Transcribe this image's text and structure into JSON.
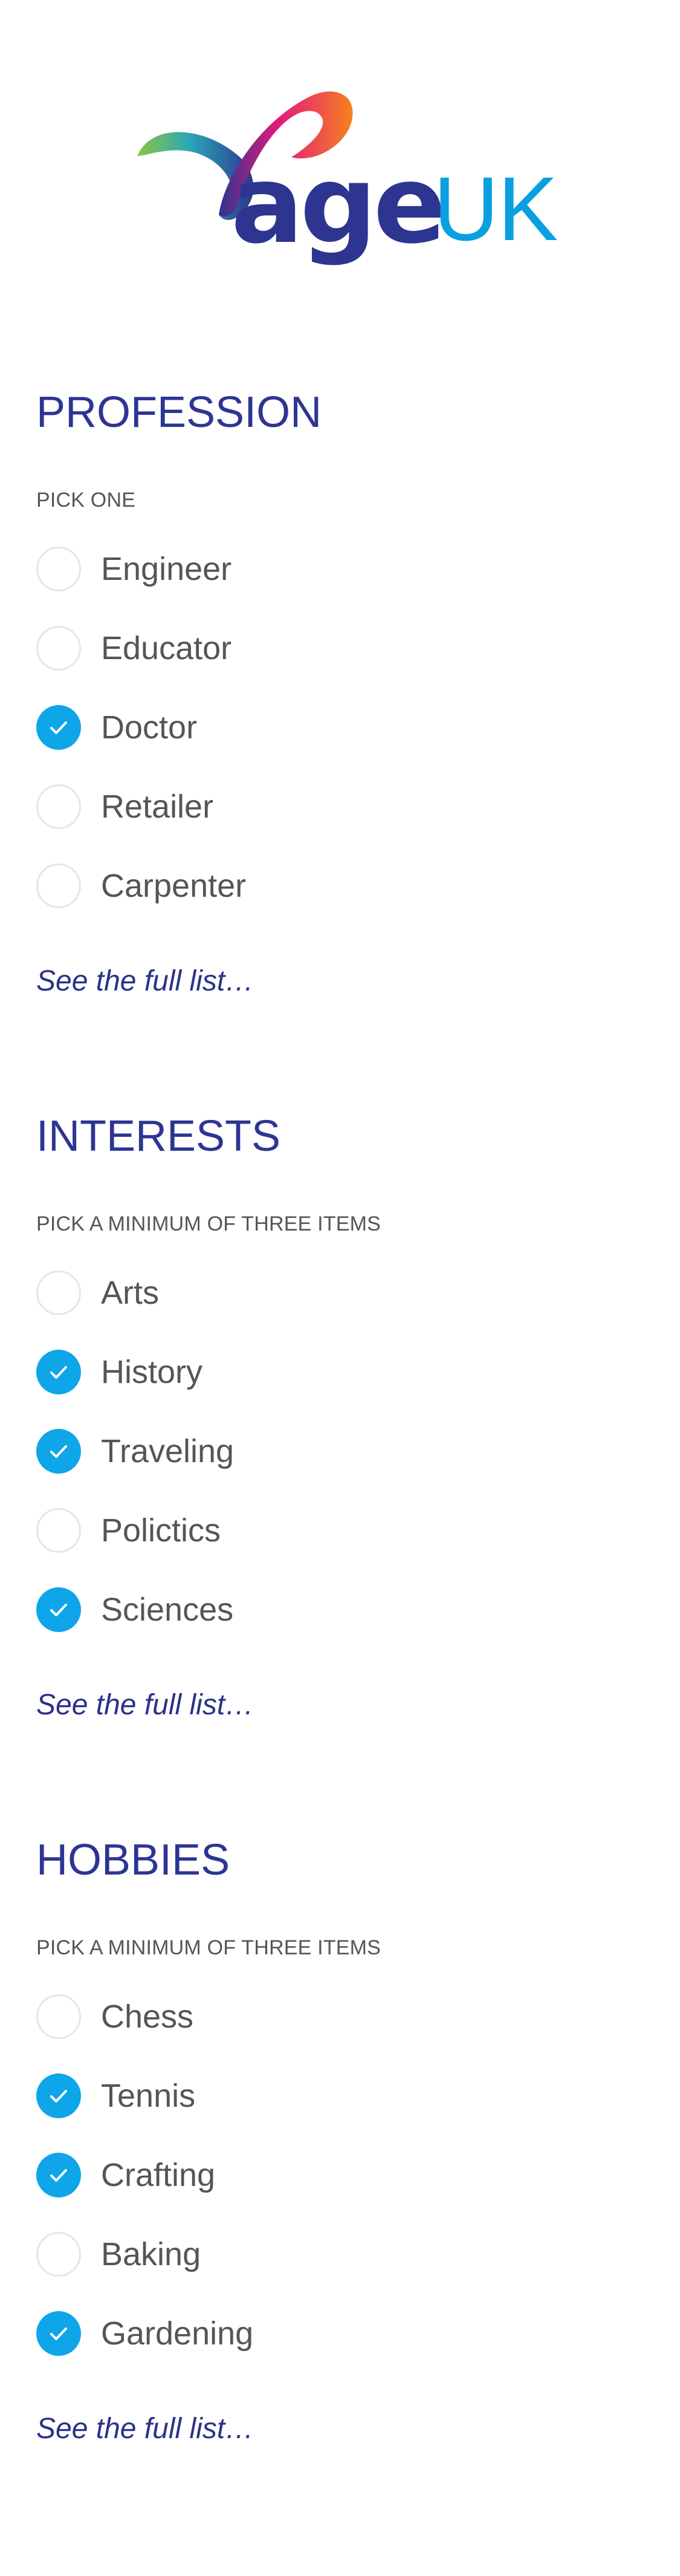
{
  "logo": {
    "word_age": "age",
    "word_uk": "UK",
    "colors": {
      "age": "#2d3590",
      "uk": "#0aa0e0"
    }
  },
  "accent_color": "#0ea5e9",
  "sections": [
    {
      "title": "PROFESSION",
      "hint": "PICK ONE",
      "options": [
        {
          "label": "Engineer",
          "checked": false
        },
        {
          "label": "Educator",
          "checked": false
        },
        {
          "label": "Doctor",
          "checked": true
        },
        {
          "label": "Retailer",
          "checked": false
        },
        {
          "label": "Carpenter",
          "checked": false
        }
      ],
      "link": "See the full list…"
    },
    {
      "title": "INTERESTS",
      "hint": "PICK A MINIMUM OF THREE ITEMS",
      "options": [
        {
          "label": "Arts",
          "checked": false
        },
        {
          "label": "History",
          "checked": true
        },
        {
          "label": "Traveling",
          "checked": true
        },
        {
          "label": "Polictics",
          "checked": false
        },
        {
          "label": "Sciences",
          "checked": true
        }
      ],
      "link": "See the full list…"
    },
    {
      "title": "HOBBIES",
      "hint": "PICK A MINIMUM OF THREE ITEMS",
      "options": [
        {
          "label": "Chess",
          "checked": false
        },
        {
          "label": "Tennis",
          "checked": true
        },
        {
          "label": "Crafting",
          "checked": true
        },
        {
          "label": "Baking",
          "checked": false
        },
        {
          "label": "Gardening",
          "checked": true
        }
      ],
      "link": "See the full list…"
    }
  ]
}
